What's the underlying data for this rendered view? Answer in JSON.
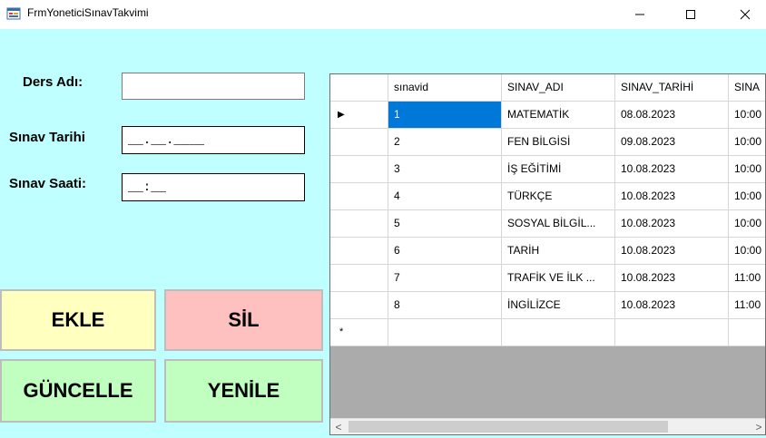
{
  "window": {
    "title": "FrmYoneticiSınavTakvimi"
  },
  "form": {
    "ders_adi_label": "Ders Adı:",
    "ders_adi_value": "",
    "sinav_tarihi_label": "Sınav Tarihi",
    "sinav_tarihi_mask": "__.__.____",
    "sinav_saati_label": "Sınav Saati:",
    "sinav_saati_mask": "__:__"
  },
  "buttons": {
    "ekle": "EKLE",
    "sil": "SİL",
    "guncelle": "GÜNCELLE",
    "yenile": "YENİLE"
  },
  "colors": {
    "background": "#c0ffff",
    "ekle": "#ffffc0",
    "sil": "#ffc0c0",
    "guncelle": "#c0ffc0",
    "yenile": "#c0ffc0",
    "selection": "#0078d7"
  },
  "grid": {
    "columns": [
      "sınavid",
      "SINAV_ADI",
      "SINAV_TARİHİ",
      "SINA"
    ],
    "rows": [
      [
        "1",
        "MATEMATİK",
        "08.08.2023",
        "10:00"
      ],
      [
        "2",
        "FEN BİLGİSİ",
        "09.08.2023",
        "10:00"
      ],
      [
        "3",
        "İŞ EĞİTİMİ",
        "10.08.2023",
        "10:00"
      ],
      [
        "4",
        "TÜRKÇE",
        "10.08.2023",
        "10:00"
      ],
      [
        "5",
        "SOSYAL BİLGİL...",
        "10.08.2023",
        "10:00"
      ],
      [
        "6",
        "TARİH",
        "10.08.2023",
        "10:00"
      ],
      [
        "7",
        "TRAFİK VE İLK ...",
        "10.08.2023",
        "11:00"
      ],
      [
        "8",
        "İNGİLİZCE",
        "10.08.2023",
        "11:00"
      ]
    ],
    "new_row_marker": "*",
    "current_row_marker": "▶",
    "scroll_left": "<",
    "scroll_right": ">"
  }
}
